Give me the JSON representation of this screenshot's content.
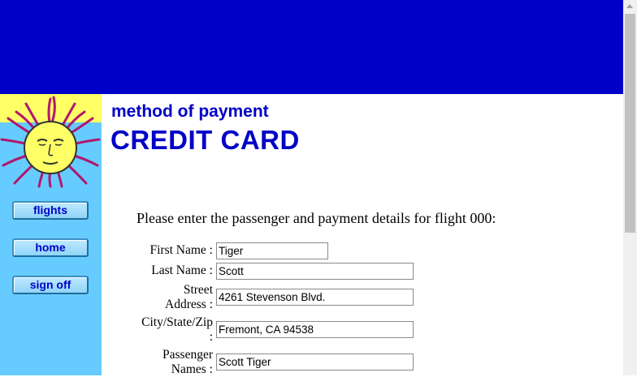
{
  "header": {
    "banner_color": "#0000c8"
  },
  "sidebar": {
    "background": "#66ccff",
    "logo_icon": "sun-face-icon",
    "nav": [
      {
        "label": "flights"
      },
      {
        "label": "home"
      },
      {
        "label": "sign off"
      }
    ]
  },
  "page": {
    "subtitle": "method of payment",
    "title": "CREDIT CARD",
    "intro": "Please enter the passenger and payment details for flight 000:"
  },
  "form": {
    "first_name": {
      "label": "First Name :",
      "value": "Tiger"
    },
    "last_name": {
      "label": "Last Name :",
      "value": "Scott"
    },
    "street": {
      "label_line1": "Street",
      "label_line2": "Address :",
      "value": "4261 Stevenson Blvd."
    },
    "city": {
      "label_line1": "City/State/Zip",
      "label_line2": ":",
      "value": "Fremont, CA 94538"
    },
    "passengers": {
      "label_line1": "Passenger",
      "label_line2": "Names :",
      "value": "Scott Tiger"
    }
  }
}
